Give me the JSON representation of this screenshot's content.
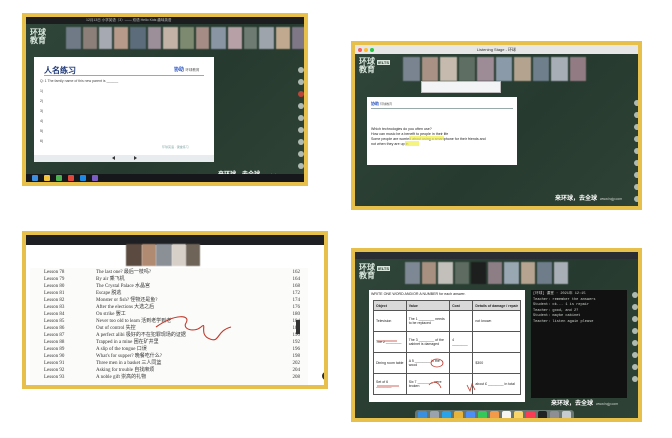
{
  "colors": {
    "frame": "#e6c04a",
    "board": "#2c3e2f",
    "highlight": "#f1f04a",
    "brand": "#2a56c6",
    "ink": "#c0392b"
  },
  "panels": {
    "top_left": {
      "window_title": "12月13日 小学英语（3）—— 双语 Hello Kids 趣味英语",
      "logo_line1": "环球",
      "logo_line2": "教育",
      "doc_title": "人名练习",
      "brand": "协助",
      "brand_sub": "环球教育",
      "question": "Q: 1   The family name of this new parent is ______",
      "numbers": [
        "1)",
        "2)",
        "3)",
        "4)",
        "5)",
        "6)"
      ],
      "doc_footer": "环球英语 · 课堂练习",
      "slogan": "来环球，去全球",
      "slogan_sub": "www.hqjy.com"
    },
    "top_right": {
      "window_title": "Listening Stage - 环球",
      "logo_line1": "环球",
      "logo_line2": "教育",
      "logo_tag": "IELTS",
      "brand": "协助",
      "brand_sub": "环球教育",
      "lines": [
        "Which technologies do you often use?",
        "How can music be a benefit to people in their life",
        "Some people are worried about using a smartphone for their friends and",
        "not when they are up in"
      ],
      "highlight_word": "are up in",
      "slogan": "来环球，去全球",
      "slogan_sub": "www.hqjy.com"
    },
    "bottom_left": {
      "lessons": [
        {
          "num": "Lesson 78",
          "title": "The last one?  最后一枝吗?",
          "page": "162"
        },
        {
          "num": "Lesson 79",
          "title": "By air  乘飞机",
          "page": "164"
        },
        {
          "num": "Lesson 80",
          "title": "The Crystal Palace  水晶宫",
          "page": "168"
        },
        {
          "num": "Lesson 81",
          "title": "Escape  脱逃",
          "page": "172"
        },
        {
          "num": "Lesson 82",
          "title": "Monster or fish?  怪物还是鱼?",
          "page": "174"
        },
        {
          "num": "Lesson 83",
          "title": "After the elections  大选之后",
          "page": "176"
        },
        {
          "num": "Lesson 84",
          "title": "On strike  罢工",
          "page": "180"
        },
        {
          "num": "Lesson 85",
          "title": "Never too old to learn  活到老学到老",
          "page": "184"
        },
        {
          "num": "Lesson 86",
          "title": "Out of control  失控",
          "page": "186"
        },
        {
          "num": "Lesson 87",
          "title": "A perfect alibi  极好的不在犯罪现场的证据",
          "page": "190"
        },
        {
          "num": "Lesson 88",
          "title": "Trapped in a mine  困在矿井里",
          "page": "192"
        },
        {
          "num": "Lesson 89",
          "title": "A slip of the tongue  口误",
          "page": "196"
        },
        {
          "num": "Lesson 90",
          "title": "What's for supper?  晚餐吃什么?",
          "page": "198"
        },
        {
          "num": "Lesson 91",
          "title": "Three men in a basket  三人同篮",
          "page": "202"
        },
        {
          "num": "Lesson 92",
          "title": "Asking for trouble  自找麻烦",
          "page": "204"
        },
        {
          "num": "Lesson 93",
          "title": "A noble gift  崇高的礼物",
          "page": "208"
        }
      ]
    },
    "bottom_right": {
      "logo_line1": "环球",
      "logo_line2": "教育",
      "logo_tag": "IELTS",
      "instruction": "WRITE ONE WORD AND/OR A NUMBER for each answer.",
      "headers": [
        "Object",
        "Value",
        "Cost",
        "Details of damage / repair"
      ],
      "rows": [
        [
          "Television",
          "The 1 ________ needs to be replaced",
          "",
          "not known"
        ],
        [
          "The 2 ________",
          "The 3 ________ of the cabinet is damaged",
          "4 ________",
          ""
        ],
        [
          "Dining room table",
          "A 5 ________ in the wood",
          "",
          "$300"
        ],
        [
          "Set of 6 ________",
          "Six 7 ________ were broken",
          "",
          "about £ ________ in total"
        ]
      ],
      "terminal_lines": [
        "[环球] 课堂 · 2021年 12:15",
        "Teacher: remember the answers",
        "Student: ok... 1 is repair",
        "Teacher: good, and 2?",
        "Student: maybe cabinet",
        "Teacher: listen again please"
      ],
      "slogan": "来环球，去全球",
      "slogan_sub": "www.hqjy.com"
    }
  }
}
